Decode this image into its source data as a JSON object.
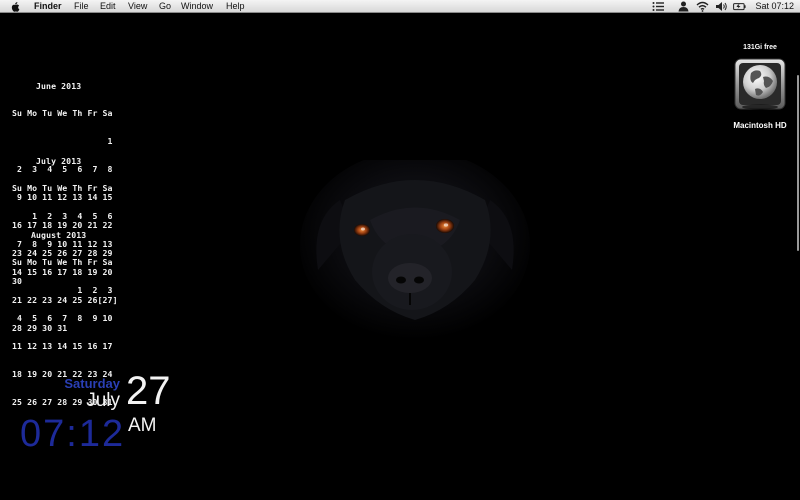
{
  "menubar": {
    "apple_icon": "apple-logo-icon",
    "app_name": "Finder",
    "items": [
      "File",
      "Edit",
      "View",
      "Go",
      "Window",
      "Help"
    ],
    "status_icons": [
      "notification-list-icon",
      "user-icon",
      "wifi-icon",
      "volume-icon",
      "battery-icon"
    ],
    "clock": "Sat 07:12"
  },
  "calendars": [
    {
      "title": "June 2013",
      "weekdays": "Su Mo Tu We Th Fr Sa",
      "rows": [
        "                   1",
        " 2  3  4  5  6  7  8",
        " 9 10 11 12 13 14 15",
        "16 17 18 19 20 21 22",
        "23 24 25 26 27 28 29",
        "30"
      ]
    },
    {
      "title": "July 2013",
      "weekdays": "Su Mo Tu We Th Fr Sa",
      "rows": [
        "    1  2  3  4  5  6",
        " 7  8  9 10 11 12 13",
        "14 15 16 17 18 19 20",
        "21 22 23 24 25 26[27]",
        "28 29 30 31"
      ]
    },
    {
      "title": "August 2013",
      "weekdays": "Su Mo Tu We Th Fr Sa",
      "rows": [
        "             1  2  3",
        " 4  5  6  7  8  9 10",
        "11 12 13 14 15 16 17",
        "18 19 20 21 22 23 24",
        "25 26 27 28 29 30 31"
      ]
    }
  ],
  "clock_widget": {
    "day": "Saturday",
    "month": "July",
    "date": "27",
    "time": "07:12",
    "ampm": "AM",
    "colors": {
      "day": "#2a3fb5",
      "time": "#1d2a99",
      "text": "#f3f3f3"
    }
  },
  "drive": {
    "free": "131Gi free",
    "label": "Macintosh HD",
    "icon": "hard-drive-globe-icon"
  },
  "wallpaper": {
    "subject": "black-dog-icon"
  }
}
